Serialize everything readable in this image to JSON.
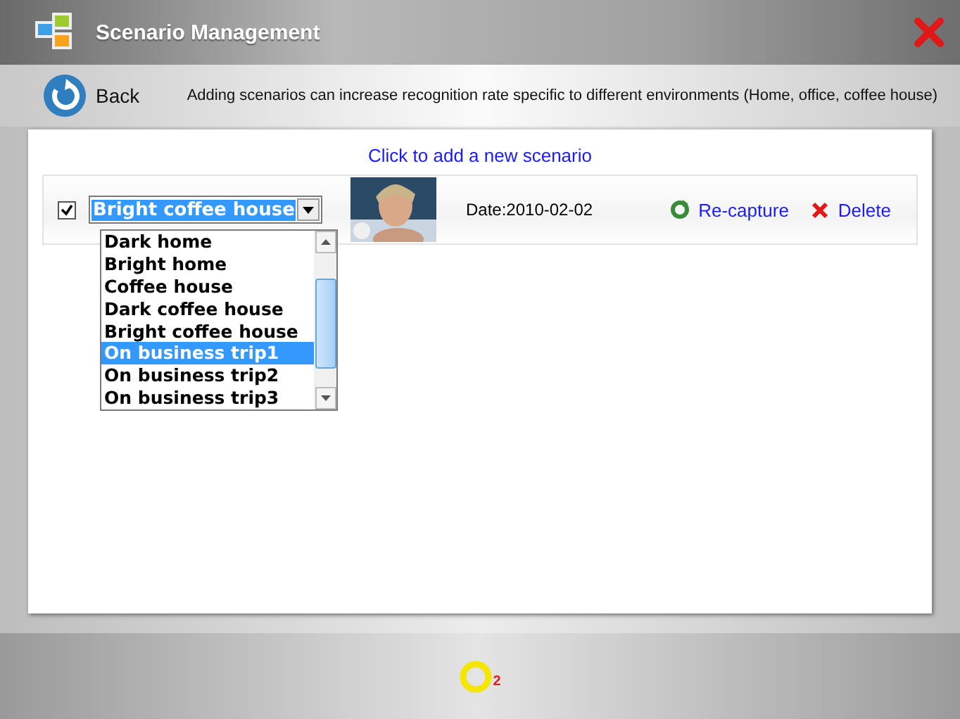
{
  "window": {
    "title": "Scenario Management"
  },
  "toolbar": {
    "back_label": "Back",
    "hint": "Adding scenarios can increase recognition rate specific to different environments (Home, office, coffee house)"
  },
  "add_link": "Click to add a new scenario",
  "scenarios": [
    {
      "checked": true,
      "name": "Bright coffee house",
      "dropdown_open": true,
      "options": [
        {
          "label": "Dark home",
          "selected": false
        },
        {
          "label": "Bright home",
          "selected": false
        },
        {
          "label": "Coffee house",
          "selected": false
        },
        {
          "label": "Dark coffee house",
          "selected": false
        },
        {
          "label": "Bright coffee house",
          "selected": false
        },
        {
          "label": "On business trip1",
          "selected": true
        },
        {
          "label": "On business trip2",
          "selected": false
        },
        {
          "label": "On business trip3",
          "selected": false
        }
      ],
      "date": "Date:2010-02-02",
      "recapture": "Re-capture",
      "delete": "Delete"
    }
  ],
  "footer": {
    "logo_subscript": "2"
  }
}
